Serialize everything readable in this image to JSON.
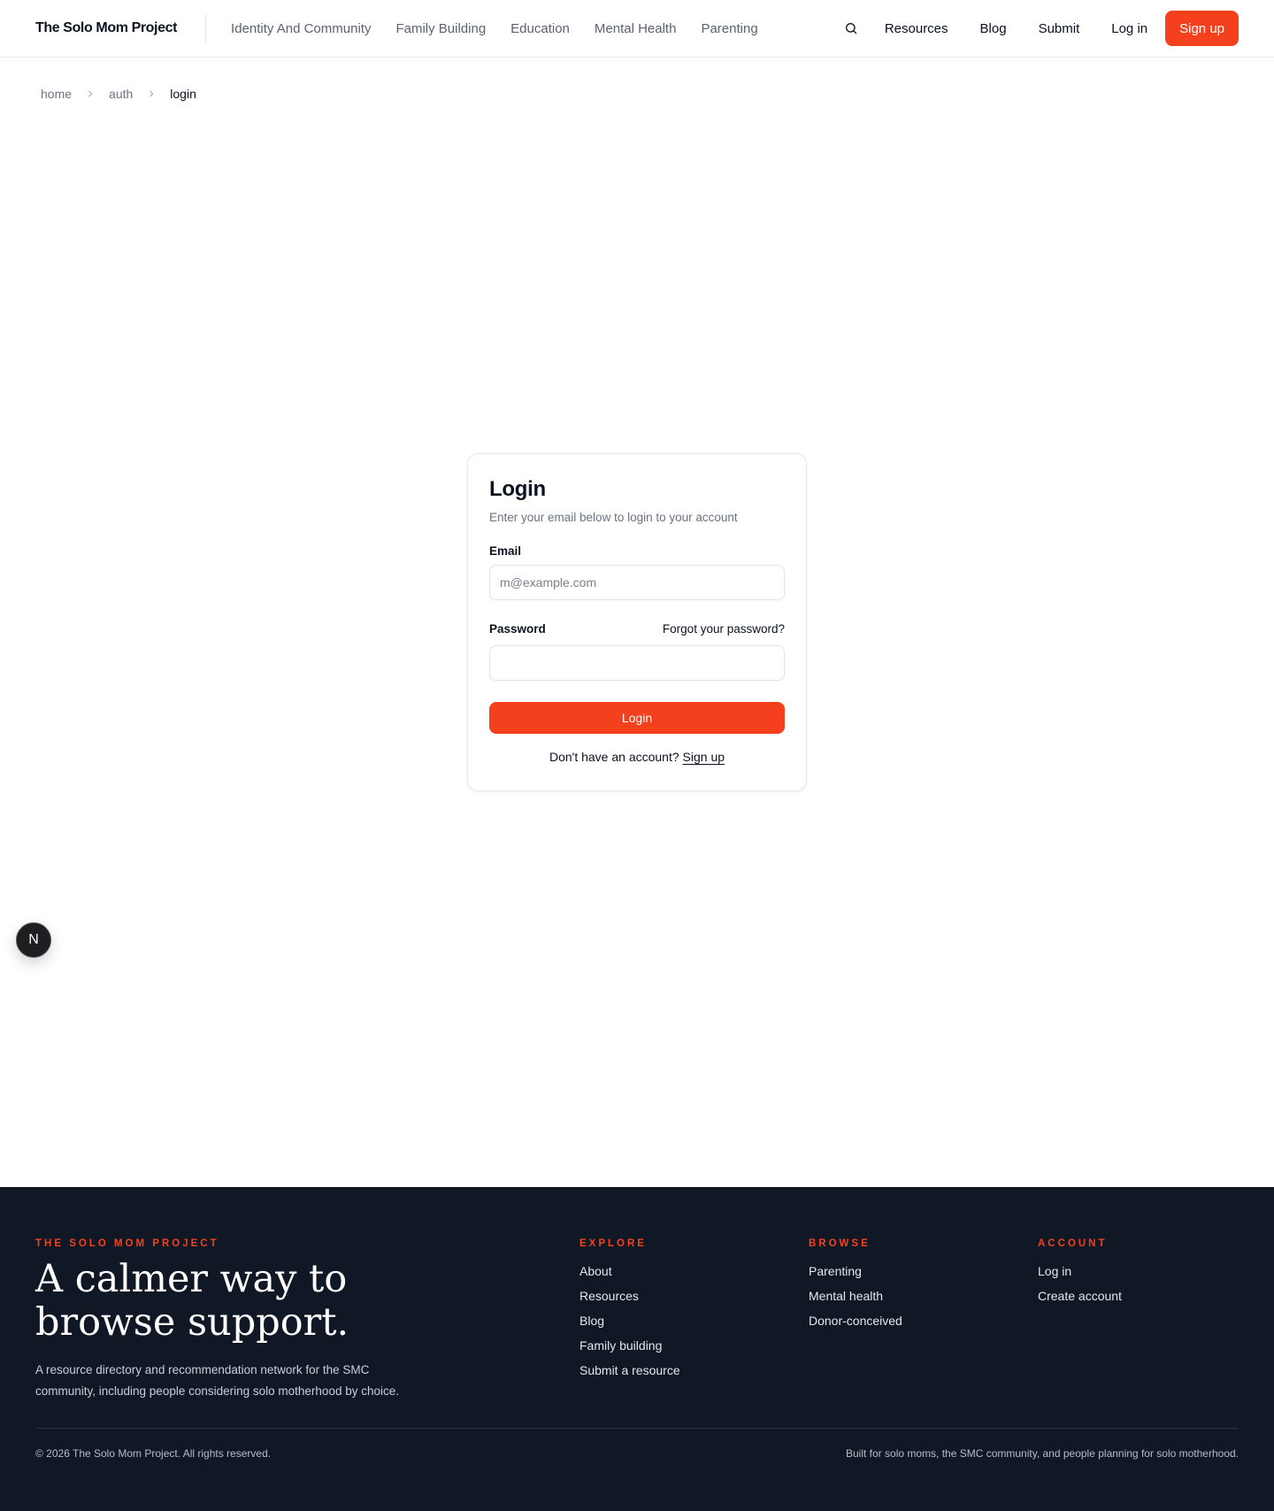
{
  "header": {
    "brand": "The Solo Mom Project",
    "nav": [
      {
        "label": "Identity And Community"
      },
      {
        "label": "Family Building"
      },
      {
        "label": "Education"
      },
      {
        "label": "Mental Health"
      },
      {
        "label": "Parenting"
      }
    ],
    "search_icon": "search-icon",
    "resources_label": "Resources",
    "blog_label": "Blog",
    "submit_label": "Submit",
    "login_label": "Log in",
    "signup_label": "Sign up"
  },
  "breadcrumb": {
    "items": [
      "home",
      "auth",
      "login"
    ]
  },
  "login": {
    "title": "Login",
    "description": "Enter your email below to login to your account",
    "email_label": "Email",
    "email_placeholder": "m@example.com",
    "email_value": "",
    "password_label": "Password",
    "password_value": "",
    "forgot_label": "Forgot your password?",
    "submit_label": "Login",
    "no_account_text": "Don't have an account?",
    "signup_link": "Sign up"
  },
  "floating_badge": {
    "letter": "N"
  },
  "footer": {
    "brand": "The Solo Mom Project",
    "tagline": "A calmer way to browse support.",
    "description": "A resource directory and recommendation network for the SMC community, including people considering solo motherhood by choice.",
    "columns": [
      {
        "heading": "Explore",
        "links": [
          "About",
          "Resources",
          "Blog",
          "Family building",
          "Submit a resource"
        ]
      },
      {
        "heading": "Browse",
        "links": [
          "Parenting",
          "Mental health",
          "Donor-conceived"
        ]
      },
      {
        "heading": "Account",
        "links": [
          "Log in",
          "Create account"
        ]
      }
    ],
    "copyright": "© 2026 The Solo Mom Project. All rights reserved.",
    "built_for": "Built for solo moms, the SMC community, and people planning for solo motherhood."
  },
  "colors": {
    "accent": "#f4401d",
    "footer_bg": "#101826",
    "text": "#0b1220",
    "muted": "#6b7280"
  }
}
